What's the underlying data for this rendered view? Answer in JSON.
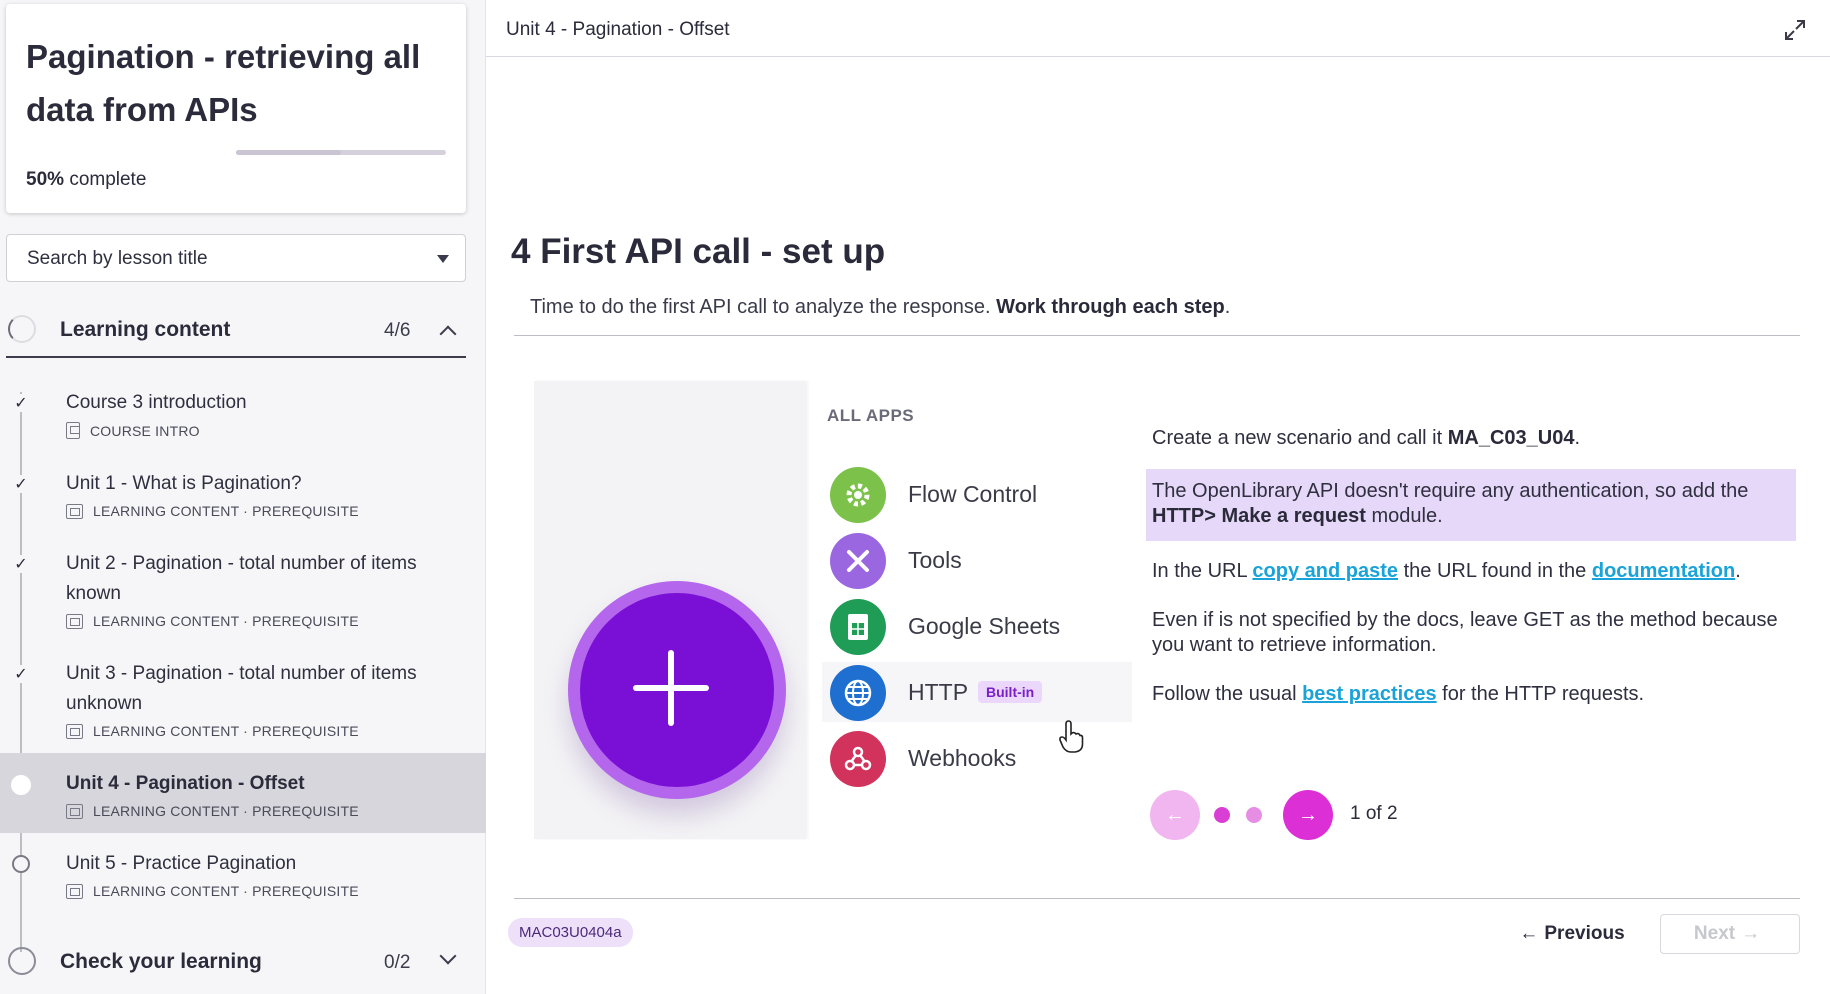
{
  "course": {
    "title": "Pagination - retrieving all data from APIs",
    "progress_percent": 50,
    "progress_value": "50%",
    "progress_suffix": "complete"
  },
  "search": {
    "placeholder": "Search by lesson title"
  },
  "sections": {
    "learning": {
      "label": "Learning content",
      "count": "4/6"
    },
    "check": {
      "label": "Check your learning",
      "count": "0/2"
    }
  },
  "lessons": [
    {
      "title": "Course 3 introduction",
      "meta": "COURSE INTRO",
      "status": "done"
    },
    {
      "title": "Unit 1 - What is Pagination?",
      "meta": "LEARNING CONTENT · PREREQUISITE",
      "status": "done"
    },
    {
      "title": "Unit 2 - Pagination - total number of items known",
      "meta": "LEARNING CONTENT · PREREQUISITE",
      "status": "done"
    },
    {
      "title": "Unit 3 - Pagination - total number of items unknown",
      "meta": "LEARNING CONTENT · PREREQUISITE",
      "status": "done"
    },
    {
      "title": "Unit 4 - Pagination - Offset",
      "meta": "LEARNING CONTENT · PREREQUISITE",
      "status": "current"
    },
    {
      "title": "Unit 5 - Practice Pagination",
      "meta": "LEARNING CONTENT · PREREQUISITE",
      "status": "todo"
    }
  ],
  "topbar": {
    "breadcrumb": "Unit 4 - Pagination - Offset"
  },
  "main": {
    "title": "4 First API call - set up",
    "intro_text": "Time to do the first API call to analyze the response. ",
    "intro_bold": "Work through each step",
    "intro_end": "."
  },
  "figure": {
    "header": "ALL APPS",
    "apps": [
      {
        "name": "Flow Control",
        "icon": "gear-icon",
        "color": "#7cc24a"
      },
      {
        "name": "Tools",
        "icon": "tools-icon",
        "color": "#9b67e0"
      },
      {
        "name": "Google Sheets",
        "icon": "sheets-icon",
        "color": "#1f9d57"
      },
      {
        "name": "HTTP",
        "icon": "globe-icon",
        "color": "#1f6fd1",
        "badge": "Built-in"
      },
      {
        "name": "Webhooks",
        "icon": "webhook-icon",
        "color": "#d2335c"
      }
    ]
  },
  "steps": {
    "s1_text": "Create a new scenario and call it ",
    "s1_bold": "MA_C03_U04",
    "s1_end": ".",
    "s2_text": "The OpenLibrary API doesn't require any authentication, so add the ",
    "s2_bold": "HTTP> Make a request",
    "s2_end": " module.",
    "s3_text": "In the URL ",
    "s3_link1": "copy and paste",
    "s3_mid": " the URL found in the ",
    "s3_link2": "documentation",
    "s3_end": ".",
    "s4_text": "Even if is not specified by the docs, leave ",
    "s4_code": "GET",
    "s4_end": " as the method because you want to retrieve information.",
    "s5_text": "Follow the usual ",
    "s5_link": "best practices",
    "s5_end": " for the HTTP requests."
  },
  "carousel": {
    "counter": "1 of 2",
    "prev_glyph": "←",
    "next_glyph": "→"
  },
  "footer": {
    "code": "MAC03U0404a",
    "previous_label": "Previous",
    "next_label": "Next"
  },
  "colors": {
    "accent": "#7a0fd6",
    "link": "#1aa3d9",
    "carousel": "#dc2fd6"
  }
}
